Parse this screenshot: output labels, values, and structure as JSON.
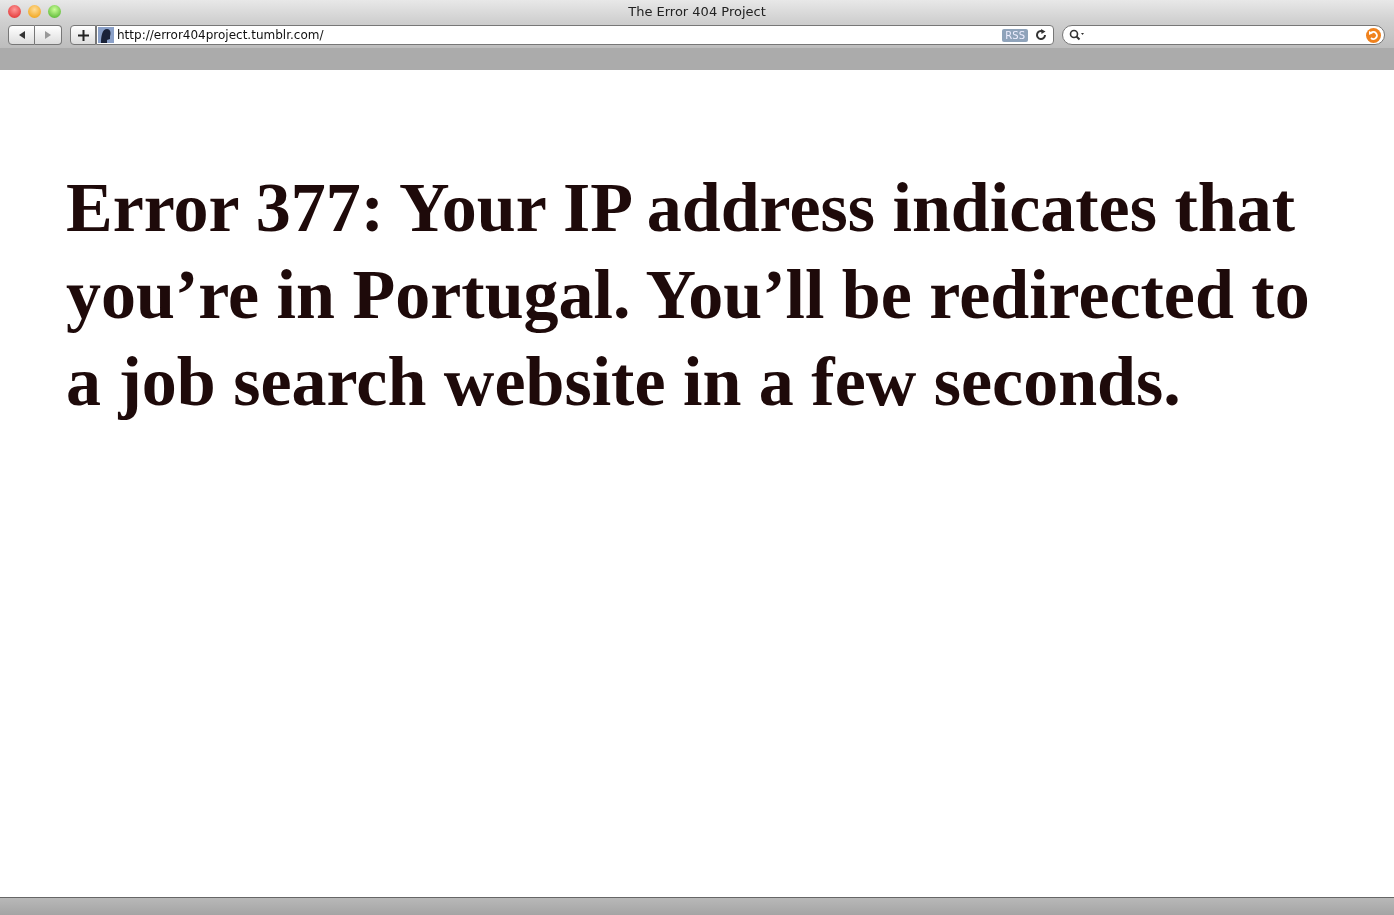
{
  "window": {
    "title": "The Error 404 Project"
  },
  "toolbar": {
    "address": "http://error404project.tumblr.com/",
    "rss": "RSS"
  },
  "page": {
    "message": "Error 377: Your IP address indicates that you’re in Portugal. You’ll be redirected to a job search website in a few seconds."
  }
}
